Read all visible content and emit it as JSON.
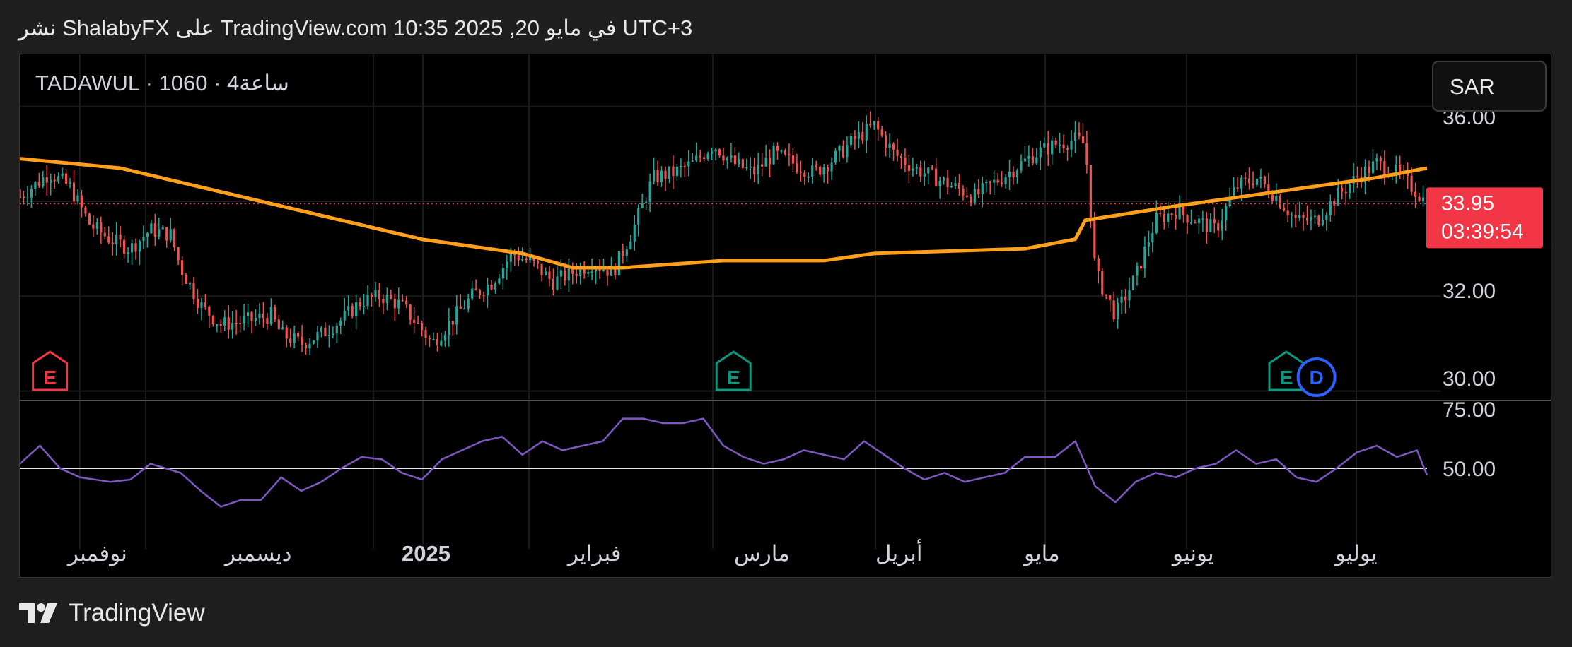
{
  "header": {
    "text": "نشر ShalabyFX على TradingView.com 10:35 2025 ,20 في مايو UTC+3"
  },
  "symbol": {
    "text": "TADAWUL · ساعة4 · 1060"
  },
  "currency": {
    "label": "SAR"
  },
  "last_price": {
    "price": "33.95",
    "countdown": "03:39:54",
    "value": 33.95
  },
  "footer": {
    "brand": "TradingView"
  },
  "colors": {
    "up": "#26a69a",
    "down": "#ef5350",
    "ma": "#ff9f1a",
    "rsi": "#7e57c2",
    "last": "#f23645"
  },
  "chart_data": {
    "type": "candlestick",
    "price_axis": {
      "ticks": [
        "36.00",
        "32.00",
        "30.00"
      ],
      "ylim": [
        29.8,
        36.8
      ]
    },
    "time_axis": {
      "ticks": [
        "نوفمبر",
        "ديسمبر",
        "2025",
        "فبراير",
        "مارس",
        "أبريل",
        "مايو",
        "يونيو",
        "يوليو"
      ]
    },
    "price_path": [
      [
        0,
        34.1
      ],
      [
        3,
        34.6
      ],
      [
        5,
        34.3
      ],
      [
        7,
        33.5
      ],
      [
        9,
        33.2
      ],
      [
        11,
        33.0
      ],
      [
        13,
        33.4
      ],
      [
        15,
        33.3
      ],
      [
        16,
        32.6
      ],
      [
        18,
        31.8
      ],
      [
        20,
        31.4
      ],
      [
        23,
        31.5
      ],
      [
        25,
        31.6
      ],
      [
        26,
        31.2
      ],
      [
        28,
        31.0
      ],
      [
        30,
        31.2
      ],
      [
        32,
        31.5
      ],
      [
        34,
        31.9
      ],
      [
        36,
        32.0
      ],
      [
        38,
        31.8
      ],
      [
        40,
        31.3
      ],
      [
        41,
        31.0
      ],
      [
        43,
        31.5
      ],
      [
        45,
        32.0
      ],
      [
        47,
        32.3
      ],
      [
        49,
        32.9
      ],
      [
        51,
        32.7
      ],
      [
        53,
        32.3
      ],
      [
        55,
        32.5
      ],
      [
        57,
        32.7
      ],
      [
        59,
        32.5
      ],
      [
        61,
        33.4
      ],
      [
        63,
        34.5
      ],
      [
        65,
        34.6
      ],
      [
        67,
        34.8
      ],
      [
        69,
        35.2
      ],
      [
        71,
        34.8
      ],
      [
        73,
        34.6
      ],
      [
        75,
        35.0
      ],
      [
        77,
        34.8
      ],
      [
        79,
        34.6
      ],
      [
        81,
        34.9
      ],
      [
        83,
        35.3
      ],
      [
        85,
        35.6
      ],
      [
        87,
        35.0
      ],
      [
        89,
        34.7
      ],
      [
        91,
        34.5
      ],
      [
        93,
        34.3
      ],
      [
        95,
        34.1
      ],
      [
        97,
        34.4
      ],
      [
        99,
        34.7
      ],
      [
        101,
        35.0
      ],
      [
        103,
        35.2
      ],
      [
        105,
        35.3
      ],
      [
        106,
        35.2
      ],
      [
        107,
        32.5
      ],
      [
        109,
        31.6
      ],
      [
        111,
        32.4
      ],
      [
        113,
        33.6
      ],
      [
        115,
        33.8
      ],
      [
        117,
        33.6
      ],
      [
        119,
        33.4
      ],
      [
        121,
        34.3
      ],
      [
        123,
        34.5
      ],
      [
        125,
        34.1
      ],
      [
        127,
        33.6
      ],
      [
        129,
        33.6
      ],
      [
        131,
        34.1
      ],
      [
        133,
        34.5
      ],
      [
        135,
        34.8
      ],
      [
        137,
        34.6
      ],
      [
        139,
        34.2
      ],
      [
        140,
        33.95
      ]
    ],
    "moving_average": [
      [
        0,
        34.9
      ],
      [
        10,
        34.7
      ],
      [
        20,
        34.2
      ],
      [
        30,
        33.7
      ],
      [
        40,
        33.2
      ],
      [
        50,
        32.9
      ],
      [
        55,
        32.6
      ],
      [
        60,
        32.6
      ],
      [
        70,
        32.75
      ],
      [
        80,
        32.75
      ],
      [
        85,
        32.9
      ],
      [
        100,
        33.0
      ],
      [
        105,
        33.2
      ],
      [
        106,
        33.6
      ],
      [
        115,
        33.9
      ],
      [
        125,
        34.2
      ],
      [
        135,
        34.5
      ],
      [
        140,
        34.7
      ]
    ],
    "earnings_markers": [
      {
        "x": 3,
        "label": "E",
        "color": "#f23645"
      },
      {
        "x": 71,
        "label": "E",
        "color": "#089981"
      },
      {
        "x": 126,
        "label": "E",
        "color": "#089981"
      }
    ],
    "dividend_markers": [
      {
        "x": 129,
        "label": "D",
        "color": "#2962ff"
      }
    ],
    "rsi": {
      "axis_ticks": [
        "75.00",
        "50.00"
      ],
      "ylim": [
        30,
        80
      ],
      "midline": 50,
      "path": [
        [
          0,
          52
        ],
        [
          2,
          60
        ],
        [
          4,
          50
        ],
        [
          6,
          46
        ],
        [
          9,
          44
        ],
        [
          11,
          45
        ],
        [
          13,
          52
        ],
        [
          16,
          48
        ],
        [
          18,
          40
        ],
        [
          20,
          33
        ],
        [
          22,
          36
        ],
        [
          24,
          36
        ],
        [
          26,
          46
        ],
        [
          28,
          40
        ],
        [
          30,
          44
        ],
        [
          32,
          50
        ],
        [
          34,
          55
        ],
        [
          36,
          54
        ],
        [
          38,
          48
        ],
        [
          40,
          45
        ],
        [
          42,
          54
        ],
        [
          44,
          58
        ],
        [
          46,
          62
        ],
        [
          48,
          64
        ],
        [
          50,
          56
        ],
        [
          52,
          62
        ],
        [
          54,
          58
        ],
        [
          56,
          60
        ],
        [
          58,
          62
        ],
        [
          60,
          72
        ],
        [
          62,
          72
        ],
        [
          64,
          70
        ],
        [
          66,
          70
        ],
        [
          68,
          72
        ],
        [
          70,
          60
        ],
        [
          72,
          55
        ],
        [
          74,
          52
        ],
        [
          76,
          54
        ],
        [
          78,
          58
        ],
        [
          80,
          56
        ],
        [
          82,
          54
        ],
        [
          84,
          62
        ],
        [
          86,
          56
        ],
        [
          88,
          50
        ],
        [
          90,
          45
        ],
        [
          92,
          48
        ],
        [
          94,
          44
        ],
        [
          96,
          46
        ],
        [
          98,
          48
        ],
        [
          100,
          55
        ],
        [
          103,
          55
        ],
        [
          105,
          62
        ],
        [
          107,
          42
        ],
        [
          109,
          35
        ],
        [
          111,
          44
        ],
        [
          113,
          48
        ],
        [
          115,
          46
        ],
        [
          117,
          50
        ],
        [
          119,
          52
        ],
        [
          121,
          58
        ],
        [
          123,
          52
        ],
        [
          125,
          54
        ],
        [
          127,
          46
        ],
        [
          129,
          44
        ],
        [
          131,
          50
        ],
        [
          133,
          57
        ],
        [
          135,
          60
        ],
        [
          137,
          55
        ],
        [
          139,
          58
        ],
        [
          140,
          47
        ]
      ]
    }
  }
}
